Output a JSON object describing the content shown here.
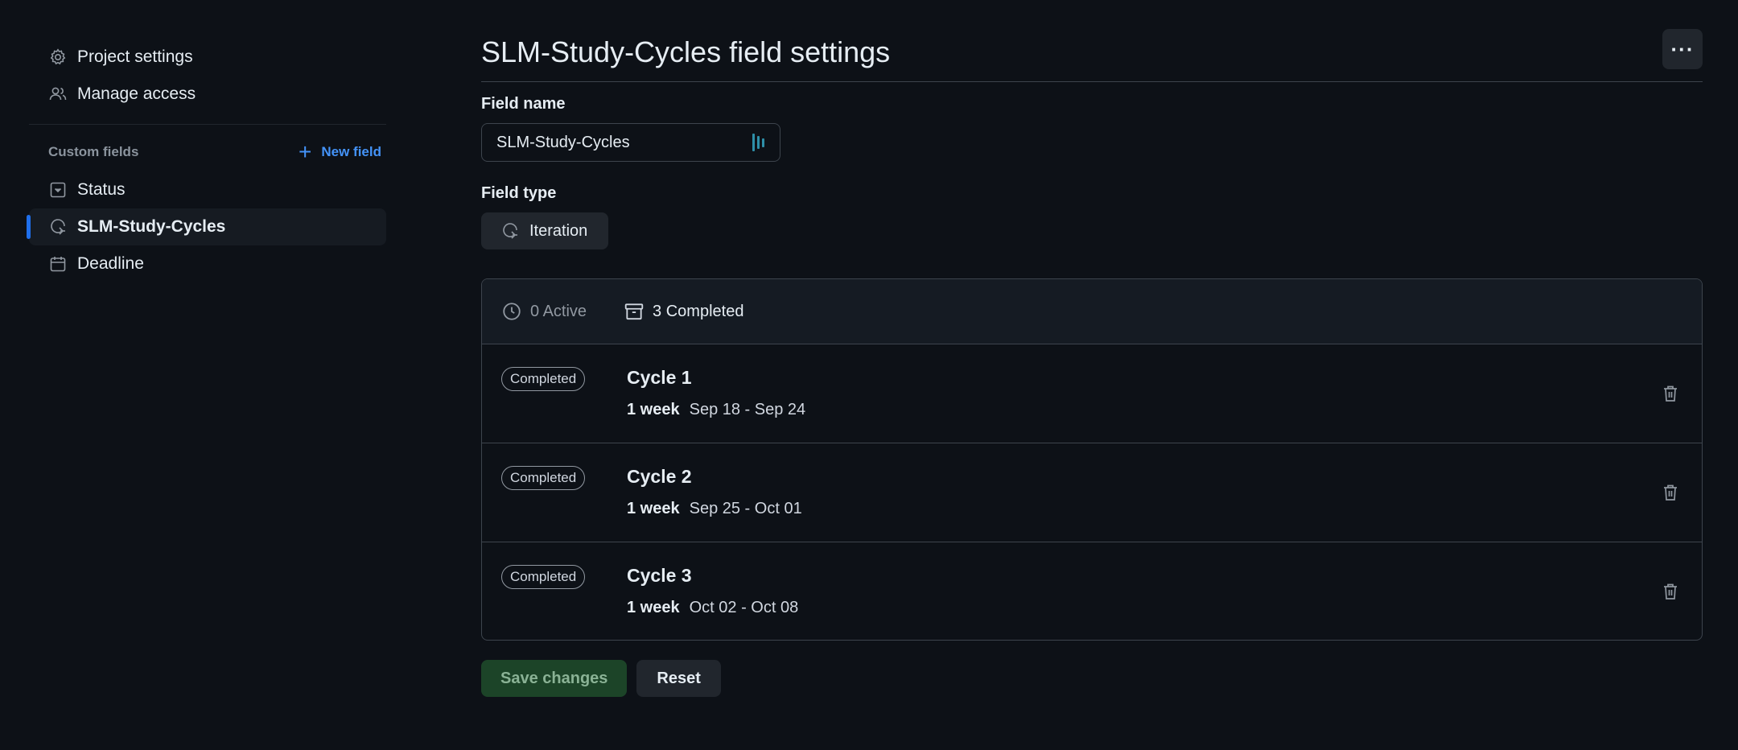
{
  "sidebar": {
    "settings_items": [
      {
        "label": "Project settings",
        "icon": "gear-icon"
      },
      {
        "label": "Manage access",
        "icon": "people-icon"
      }
    ],
    "custom_fields_label": "Custom fields",
    "new_field_label": "New field",
    "fields": [
      {
        "label": "Status",
        "icon": "single-select-icon",
        "active": false
      },
      {
        "label": "SLM-Study-Cycles",
        "icon": "iterations-icon",
        "active": true
      },
      {
        "label": "Deadline",
        "icon": "calendar-icon",
        "active": false
      }
    ]
  },
  "main": {
    "title": "SLM-Study-Cycles field settings",
    "more_button": "···",
    "field_name_label": "Field name",
    "field_name_value": "SLM-Study-Cycles",
    "field_type_label": "Field type",
    "field_type_value": "Iteration",
    "tabs": [
      {
        "label": "0 Active",
        "icon": "clock-icon",
        "selected": false
      },
      {
        "label": "3 Completed",
        "icon": "archive-icon",
        "selected": true
      }
    ],
    "iterations": [
      {
        "badge": "Completed",
        "title": "Cycle 1",
        "duration": "1 week",
        "dates": "Sep 18 - Sep 24"
      },
      {
        "badge": "Completed",
        "title": "Cycle 2",
        "duration": "1 week",
        "dates": "Sep 25 - Oct 01"
      },
      {
        "badge": "Completed",
        "title": "Cycle 3",
        "duration": "1 week",
        "dates": "Oct 02 - Oct 08"
      }
    ],
    "save_label": "Save changes",
    "reset_label": "Reset"
  },
  "colors": {
    "background": "#0d1117",
    "accent_blue": "#4493f8",
    "active_indicator": "#1f6feb",
    "save_button_bg": "#1c4428"
  }
}
